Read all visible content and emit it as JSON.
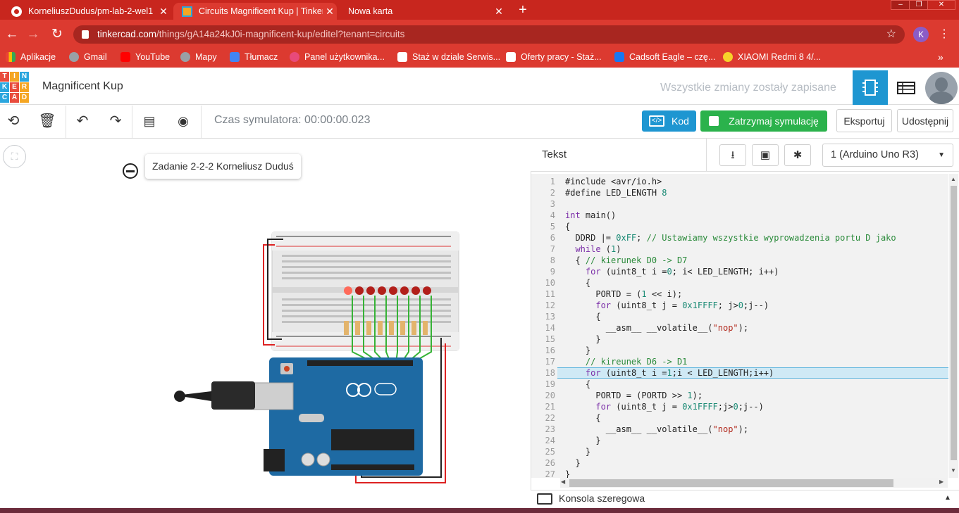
{
  "browser": {
    "tabs": [
      {
        "title": "KorneliuszDudus/pm-lab-2-wel1",
        "active": false
      },
      {
        "title": "Circuits Magnificent Kup | Tinkerc",
        "active": true
      },
      {
        "title": "Nowa karta",
        "active": false
      }
    ],
    "new_tab_icon": "plus-icon",
    "address": {
      "host": "tinkercad.com",
      "path": "/things/gA14a24kJ0i-magnificent-kup/editel?tenant=circuits"
    },
    "profile_initial": "K",
    "bookmarks": [
      {
        "label": "Aplikacje",
        "icon": "apps-grid-icon",
        "color": "#4285f4"
      },
      {
        "label": "Gmail",
        "icon": "globe-icon",
        "color": "#9aa0a6"
      },
      {
        "label": "YouTube",
        "icon": "youtube-icon",
        "color": "#ff0000"
      },
      {
        "label": "Mapy",
        "icon": "globe-icon",
        "color": "#9aa0a6"
      },
      {
        "label": "Tłumacz",
        "icon": "translate-icon",
        "color": "#4285f4"
      },
      {
        "label": "Panel użytkownika...",
        "icon": "panel-icon",
        "color": "#e84a7a"
      },
      {
        "label": "Staż w dziale Serwis...",
        "icon": "job-icon",
        "color": "#ffffff"
      },
      {
        "label": "Oferty pracy - Staż...",
        "icon": "job-icon",
        "color": "#ffffff"
      },
      {
        "label": "Cadsoft Eagle – czę...",
        "icon": "facebook-icon",
        "color": "#1877f2"
      },
      {
        "label": "XIAOMI Redmi 8 4/...",
        "icon": "play-icon",
        "color": "#f7d12a"
      }
    ]
  },
  "app": {
    "logo_letters": [
      "T",
      "I",
      "N",
      "K",
      "E",
      "R",
      "C",
      "A",
      "D"
    ],
    "logo_colors": [
      "#e94c3d",
      "#f5a623",
      "#2ba6de",
      "#e94c3d",
      "#f5a623",
      "#2ba6de",
      "#2ba6de",
      "#e94c3d",
      "#f5a623"
    ],
    "project_title": "Magnificent Kup",
    "save_status": "Wszystkie zmiany zostały zapisane"
  },
  "toolbar": {
    "sim_time": "Czas symulatora: 00:00:00.023",
    "code_label": "Kod",
    "stop_label": "Zatrzymaj symulację",
    "export_label": "Eksportuj",
    "share_label": "Udostępnij"
  },
  "canvas": {
    "note_text": "Zadanie 2-2-2 Korneliusz Duduś"
  },
  "code_panel": {
    "mode_label": "Tekst",
    "device": "1 (Arduino Uno R3)",
    "highlighted_line": 18,
    "lines": [
      "#include <avr/io.h>",
      "#define LED_LENGTH 8",
      "",
      "int main()",
      "{",
      "  DDRD |= 0xFF; // Ustawiamy wszystkie wyprowadzenia portu D jako",
      "  while (1)",
      "  { // kierunek D0 -> D7",
      "    for (uint8_t i =0; i< LED_LENGTH; i++)",
      "    {",
      "      PORTD = (1 << i);",
      "      for (uint8_t j = 0x1FFFF; j>0;j--)",
      "      {",
      "        __asm__ __volatile__(\"nop\");",
      "      }",
      "    }",
      "    // kireunek D6 -> D1",
      "    for (uint8_t i =1;i < LED_LENGTH;i++)",
      "    {",
      "      PORTD = (PORTD >> 1);",
      "      for (uint8_t j = 0x1FFFF;j>0;j--)",
      "      {",
      "        __asm__ __volatile__(\"nop\");",
      "      }",
      "    }",
      "  }",
      "}"
    ],
    "console_label": "Konsola szeregowa"
  }
}
